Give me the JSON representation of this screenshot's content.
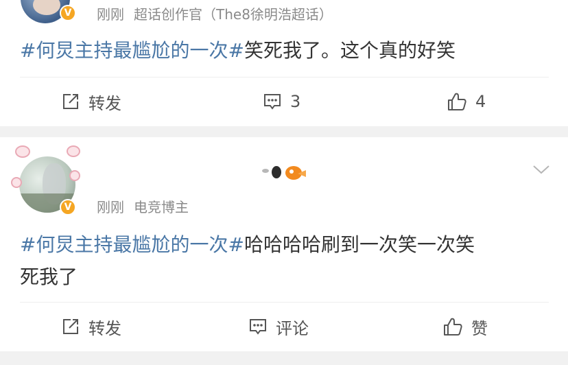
{
  "posts": [
    {
      "time": "刚刚",
      "source": "超话创作官（The8徐明浩超话）",
      "hashtag": "#何炅主持最尴尬的一次#",
      "body_line1": "笑死我了。这个真的好笑",
      "body_line2": "",
      "actions": {
        "repost": "转发",
        "comment": "3",
        "like": "4"
      }
    },
    {
      "time": "刚刚",
      "source": "电竞博主",
      "hashtag": "#何炅主持最尴尬的一次#",
      "body_line1": "哈哈哈哈刷到一次笑一次笑",
      "body_line2": "死我了",
      "actions": {
        "repost": "转发",
        "comment": "评论",
        "like": "赞"
      }
    }
  ],
  "badge_symbol": "V",
  "icons": {
    "repost": "repost-icon",
    "comment": "comment-icon",
    "like": "like-icon",
    "more": "chevron-down-icon",
    "decoration": "goldfish-sticker-icon"
  },
  "colors": {
    "hashtag": "#4a77a6",
    "meta": "#8a8a8a",
    "badge": "#f5a623",
    "separator": "#f1f1f1"
  }
}
